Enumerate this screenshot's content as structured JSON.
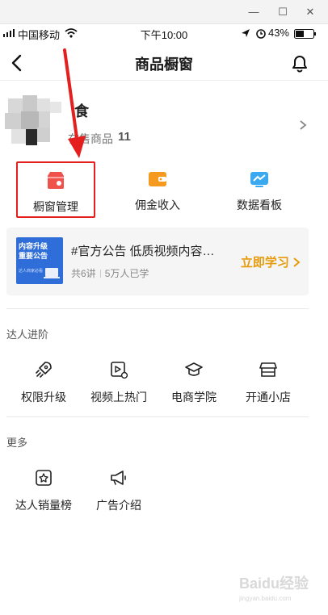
{
  "window": {
    "minimize": "—",
    "maximize": "☐",
    "close": "✕"
  },
  "status_bar": {
    "carrier": "中国移动",
    "time": "下午10:00",
    "battery": "43%"
  },
  "nav": {
    "title": "商品橱窗"
  },
  "profile": {
    "name": "食",
    "count_label": "在售商品",
    "count": "11"
  },
  "quick_actions": [
    {
      "label": "橱窗管理",
      "icon": "shop-icon",
      "color": "#f0524b"
    },
    {
      "label": "佣金收入",
      "icon": "wallet-icon",
      "color": "#f59a1f"
    },
    {
      "label": "数据看板",
      "icon": "chart-board-icon",
      "color": "#3aa9f0"
    }
  ],
  "notice": {
    "thumb_line1": "内容升级",
    "thumb_line2": "重要公告",
    "thumb_line3": "达人商家必看",
    "title": "#官方公告 低质视频内容…",
    "lessons": "共6讲",
    "learners": "5万人已学",
    "cta": "立即学习"
  },
  "sections": {
    "advance": {
      "title": "达人进阶",
      "items": [
        {
          "label": "权限升级",
          "icon": "rocket-icon"
        },
        {
          "label": "视频上热门",
          "icon": "video-hot-icon"
        },
        {
          "label": "电商学院",
          "icon": "graduation-cap-icon"
        },
        {
          "label": "开通小店",
          "icon": "store-icon"
        }
      ]
    },
    "more": {
      "title": "更多",
      "items": [
        {
          "label": "达人销量榜",
          "icon": "rank-badge-icon"
        },
        {
          "label": "广告介绍",
          "icon": "megaphone-icon"
        }
      ]
    }
  },
  "watermark": {
    "brand": "Baidu经验",
    "url": "jingyan.baidu.com"
  },
  "colors": {
    "highlight_border": "#e51e1e",
    "arrow": "#e51e1e",
    "cta": "#e69b0a"
  }
}
